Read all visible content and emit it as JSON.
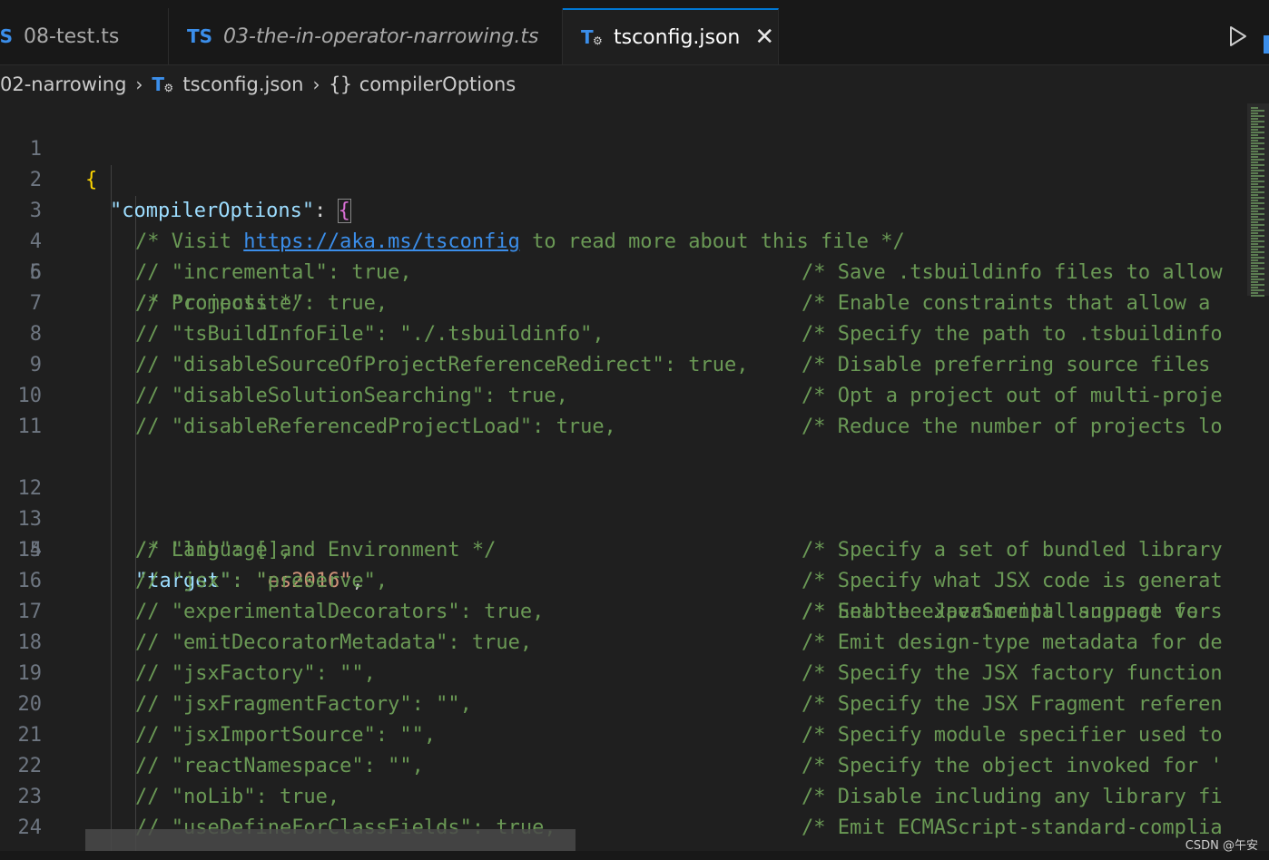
{
  "tabs": [
    {
      "label": "08-test.ts",
      "badge": "TS",
      "active": false
    },
    {
      "label": "03-the-in-operator-narrowing.ts",
      "badge": "TS",
      "active": false
    },
    {
      "label": "tsconfig.json",
      "badge": "TS",
      "active": true
    }
  ],
  "breadcrumb": {
    "folder": "02-narrowing",
    "file": "tsconfig.json",
    "braces": "{}",
    "symbol": "compilerOptions"
  },
  "editor": {
    "line_numbers": [
      "1",
      "2",
      "3",
      "4",
      "5",
      "6",
      "7",
      "8",
      "9",
      "10",
      "11",
      "12",
      "13",
      "14",
      "15",
      "16",
      "17",
      "18",
      "19",
      "20",
      "21",
      "22",
      "23",
      "24"
    ],
    "l1": "{",
    "l2_key": "\"compilerOptions\"",
    "l2_colon": ": ",
    "l2_brace": "{",
    "l3_pre": "/* Visit ",
    "l3_link": "https://aka.ms/tsconfig",
    "l3_post": " to read more about this file */",
    "l5": "/* Projects */",
    "l13": "/* Language and Environment */",
    "l14_key": "\"target\"",
    "l14_colon": ": ",
    "l14_val": "\"es2016\"",
    "l14_comma": ",",
    "rows": [
      {
        "n": 6,
        "code": "// \"incremental\": true,",
        "comment": "/* Save .tsbuildinfo files to allow"
      },
      {
        "n": 7,
        "code": "// \"composite\": true,",
        "comment": "/* Enable constraints that allow a"
      },
      {
        "n": 8,
        "code": "// \"tsBuildInfoFile\": \"./.tsbuildinfo\",",
        "comment": "/* Specify the path to .tsbuildinfo"
      },
      {
        "n": 9,
        "code": "// \"disableSourceOfProjectReferenceRedirect\": true,",
        "comment": "/* Disable preferring source files"
      },
      {
        "n": 10,
        "code": "// \"disableSolutionSearching\": true,",
        "comment": "/* Opt a project out of multi-proje"
      },
      {
        "n": 11,
        "code": "// \"disableReferencedProjectLoad\": true,",
        "comment": "/* Reduce the number of projects lo"
      },
      {
        "n": 15,
        "code": "// \"lib\": [],",
        "comment": "/* Specify a set of bundled library"
      },
      {
        "n": 16,
        "code": "// \"jsx\": \"preserve\",",
        "comment": "/* Specify what JSX code is generat"
      },
      {
        "n": 17,
        "code": "// \"experimentalDecorators\": true,",
        "comment": "/* Enable experimental support for"
      },
      {
        "n": 18,
        "code": "// \"emitDecoratorMetadata\": true,",
        "comment": "/* Emit design-type metadata for de"
      },
      {
        "n": 19,
        "code": "// \"jsxFactory\": \"\",",
        "comment": "/* Specify the JSX factory function"
      },
      {
        "n": 20,
        "code": "// \"jsxFragmentFactory\": \"\",",
        "comment": "/* Specify the JSX Fragment referen"
      },
      {
        "n": 21,
        "code": "// \"jsxImportSource\": \"\",",
        "comment": "/* Specify module specifier used to"
      },
      {
        "n": 22,
        "code": "// \"reactNamespace\": \"\",",
        "comment": "/* Specify the object invoked for '"
      },
      {
        "n": 23,
        "code": "// \"noLib\": true,",
        "comment": "/* Disable including any library fi"
      },
      {
        "n": 24,
        "code": "// \"useDefineForClassFields\": true,",
        "comment": "/* Emit ECMAScript-standard-complia"
      }
    ],
    "l14_comment": "/* Set the JavaScript language vers"
  },
  "watermark": "CSDN @午安⁠⁠",
  "colors": {
    "background": "#1f1f1f",
    "comment": "#6a9955",
    "key": "#9cdcfe",
    "string": "#ce9178",
    "accent": "#0078d4",
    "ts_badge": "#3b8eea"
  },
  "icons": [
    "ts-file-icon",
    "tsconfig-file-icon",
    "close-icon",
    "run-icon",
    "chevron-right-icon",
    "braces-icon"
  ]
}
